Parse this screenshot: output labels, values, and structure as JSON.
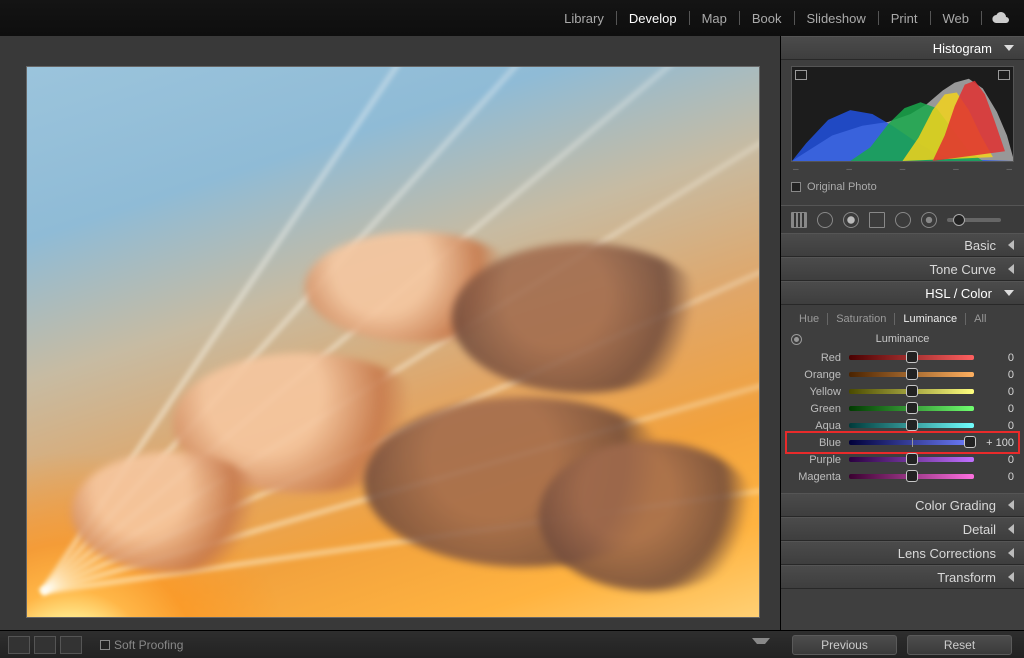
{
  "topnav": {
    "items": [
      "Library",
      "Develop",
      "Map",
      "Book",
      "Slideshow",
      "Print",
      "Web"
    ],
    "active": "Develop"
  },
  "panels": {
    "histogram": {
      "title": "Histogram",
      "original": "Original Photo"
    },
    "basic": "Basic",
    "tonecurve": "Tone Curve",
    "hsl": {
      "title": "HSL / Color",
      "tabs": [
        "Hue",
        "Saturation",
        "Luminance",
        "All"
      ],
      "active": "Luminance",
      "section_label": "Luminance",
      "rows": [
        {
          "name": "Red",
          "value": 0,
          "pos": 50,
          "grad": "linear-gradient(90deg,#490000,#ff6060)"
        },
        {
          "name": "Orange",
          "value": 0,
          "pos": 50,
          "grad": "linear-gradient(90deg,#4a2300,#ffb060)"
        },
        {
          "name": "Yellow",
          "value": 0,
          "pos": 50,
          "grad": "linear-gradient(90deg,#4a4a00,#ffff80)"
        },
        {
          "name": "Green",
          "value": 0,
          "pos": 50,
          "grad": "linear-gradient(90deg,#003a00,#70ff70)"
        },
        {
          "name": "Aqua",
          "value": 0,
          "pos": 50,
          "grad": "linear-gradient(90deg,#003a3a,#70ffff)"
        },
        {
          "name": "Blue",
          "value": 100,
          "pos": 97,
          "grad": "linear-gradient(90deg,#00003a,#7080ff)",
          "highlight": true,
          "display": "+ 100"
        },
        {
          "name": "Purple",
          "value": 0,
          "pos": 50,
          "grad": "linear-gradient(90deg,#2a0040,#c070ff)"
        },
        {
          "name": "Magenta",
          "value": 0,
          "pos": 50,
          "grad": "linear-gradient(90deg,#3a0030,#ff70e0)"
        }
      ]
    },
    "colorgrading": "Color Grading",
    "detail": "Detail",
    "lens": "Lens Corrections",
    "transform": "Transform"
  },
  "bottom": {
    "softproof": "Soft Proofing",
    "previous": "Previous",
    "reset": "Reset"
  }
}
